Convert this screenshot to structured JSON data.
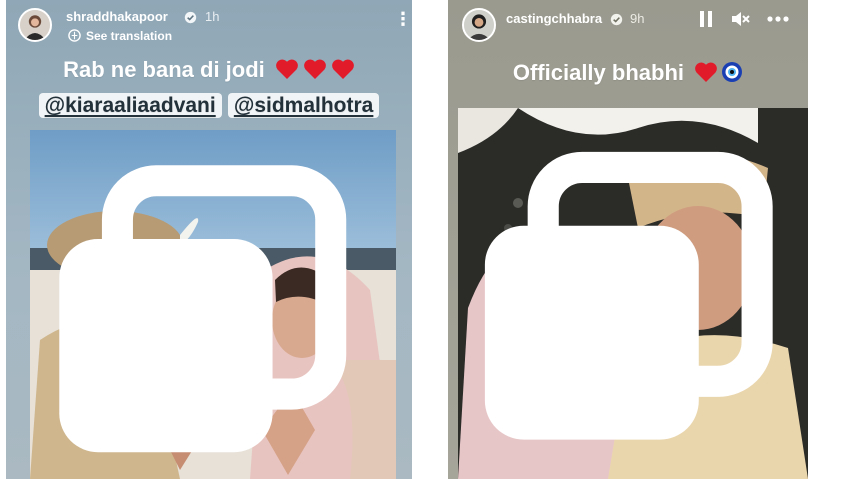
{
  "left_story": {
    "username": "shraddhakapoor",
    "time": "1h",
    "translate_label": "See translation",
    "caption_line1": "Rab ne bana di jodi",
    "mentions": [
      "@kiaraaliaadvani",
      "@sidmalhotra"
    ],
    "hearts_count": 3
  },
  "right_story": {
    "username": "castingchhabra",
    "time": "9h",
    "caption": "Officially bhabhi"
  },
  "colors": {
    "heart": "#e21b2a",
    "verified": "#3897f0",
    "left_bg": "#9fb3bf",
    "right_bg": "#a4a397"
  },
  "icons": [
    "verified-icon",
    "translate-icon",
    "more-vertical-icon",
    "pause-icon",
    "mute-icon",
    "more-horizontal-icon",
    "heart-icon",
    "evil-eye-icon",
    "multi-image-icon"
  ]
}
